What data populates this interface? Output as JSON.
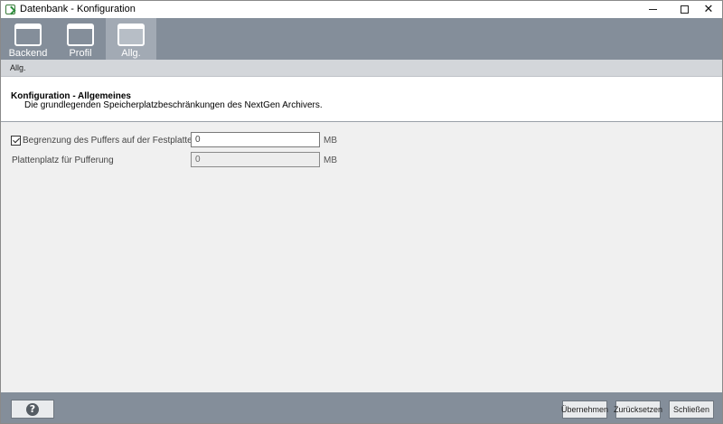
{
  "window": {
    "title": "Datenbank - Konfiguration",
    "controls": {
      "minimize": "–",
      "maximize": "□",
      "close": "✕"
    }
  },
  "toolbar": {
    "tabs": [
      {
        "label": "Backend",
        "icon": "window-icon",
        "active": false
      },
      {
        "label": "Profil",
        "icon": "window-icon",
        "active": false
      },
      {
        "label": "Allg.",
        "icon": "window-icon",
        "active": true
      }
    ]
  },
  "breadcrumb": {
    "text": "Allg."
  },
  "header": {
    "title": "Konfiguration - Allgemeines",
    "subtitle": "Die grundlegenden Speicherplatzbeschränkungen des NextGen Archivers."
  },
  "settings": {
    "buffer_limit": {
      "label": "Begrenzung des Puffers auf der Festplatte:",
      "checked": true,
      "value": "0",
      "unit": "MB"
    },
    "buffer_space": {
      "label": "Plattenplatz für Pufferung",
      "value": "0",
      "unit": "MB"
    }
  },
  "footer": {
    "help_label": "?",
    "apply_label": "Übernehmen",
    "reset_label": "Zurücksetzen",
    "close_label": "Schließen"
  },
  "colors": {
    "toolbar_bg": "#848e9a",
    "active_tab_bg": "#a2aab4",
    "breadcrumb_bg": "#d3d6da",
    "content_bg": "#f0f0f0"
  }
}
